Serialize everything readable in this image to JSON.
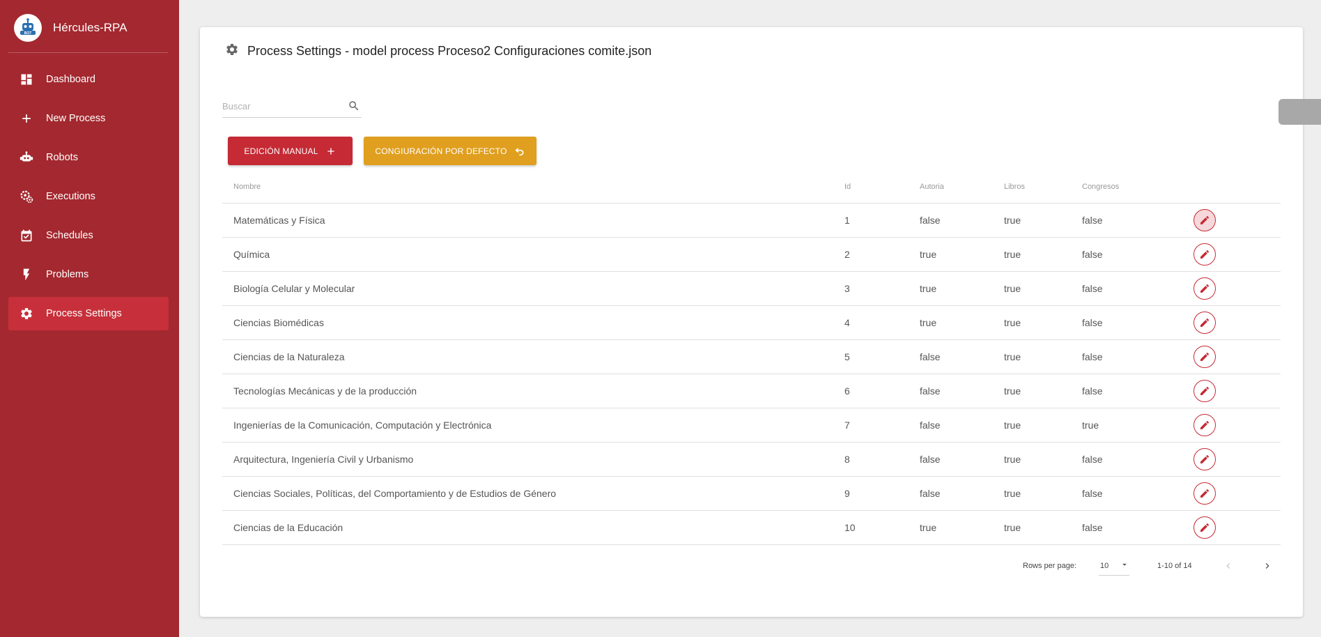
{
  "brand": {
    "title": "Hércules-RPA",
    "logo_text": "BOT"
  },
  "nav": {
    "items": [
      {
        "label": "Dashboard",
        "icon": "dashboard-icon"
      },
      {
        "label": "New Process",
        "icon": "plus-icon"
      },
      {
        "label": "Robots",
        "icon": "robot-icon"
      },
      {
        "label": "Executions",
        "icon": "gears-icon"
      },
      {
        "label": "Schedules",
        "icon": "calendar-check-icon"
      },
      {
        "label": "Problems",
        "icon": "flash-icon"
      },
      {
        "label": "Process Settings",
        "icon": "gear-icon",
        "active": true
      }
    ]
  },
  "header": {
    "title": "Process Settings - model process Proceso2 Configuraciones comite.json"
  },
  "search": {
    "placeholder": "Buscar",
    "value": ""
  },
  "actions": {
    "manual_label": "EDICIÓN MANUAL",
    "default_label": "CONGIURACIÓN POR DEFECTO"
  },
  "table": {
    "columns": [
      "Nombre",
      "Id",
      "Autoria",
      "Libros",
      "Congresos"
    ],
    "rows": [
      {
        "nombre": "Matemáticas y Física",
        "id": "1",
        "autoria": "false",
        "libros": "true",
        "congresos": "false"
      },
      {
        "nombre": "Química",
        "id": "2",
        "autoria": "true",
        "libros": "true",
        "congresos": "false"
      },
      {
        "nombre": "Biología Celular y Molecular",
        "id": "3",
        "autoria": "true",
        "libros": "true",
        "congresos": "false"
      },
      {
        "nombre": "Ciencias Biomédicas",
        "id": "4",
        "autoria": "true",
        "libros": "true",
        "congresos": "false"
      },
      {
        "nombre": "Ciencias de la Naturaleza",
        "id": "5",
        "autoria": "false",
        "libros": "true",
        "congresos": "false"
      },
      {
        "nombre": "Tecnologías Mecánicas y de la producción",
        "id": "6",
        "autoria": "false",
        "libros": "true",
        "congresos": "false"
      },
      {
        "nombre": "Ingenierías de la Comunicación, Computación y Electrónica",
        "id": "7",
        "autoria": "false",
        "libros": "true",
        "congresos": "true"
      },
      {
        "nombre": "Arquitectura, Ingeniería Civil y Urbanismo",
        "id": "8",
        "autoria": "false",
        "libros": "true",
        "congresos": "false"
      },
      {
        "nombre": "Ciencias Sociales, Políticas, del Comportamiento y de Estudios de Género",
        "id": "9",
        "autoria": "false",
        "libros": "true",
        "congresos": "false"
      },
      {
        "nombre": "Ciencias de la Educación",
        "id": "10",
        "autoria": "true",
        "libros": "true",
        "congresos": "false"
      }
    ]
  },
  "pagination": {
    "rows_per_page_label": "Rows per page:",
    "rows_per_page": "10",
    "range": "1-10 of 14"
  },
  "colors": {
    "sidebar": "#a4282f",
    "active": "#c7303a",
    "primary": "#c52a35",
    "warning": "#e09f1f"
  }
}
